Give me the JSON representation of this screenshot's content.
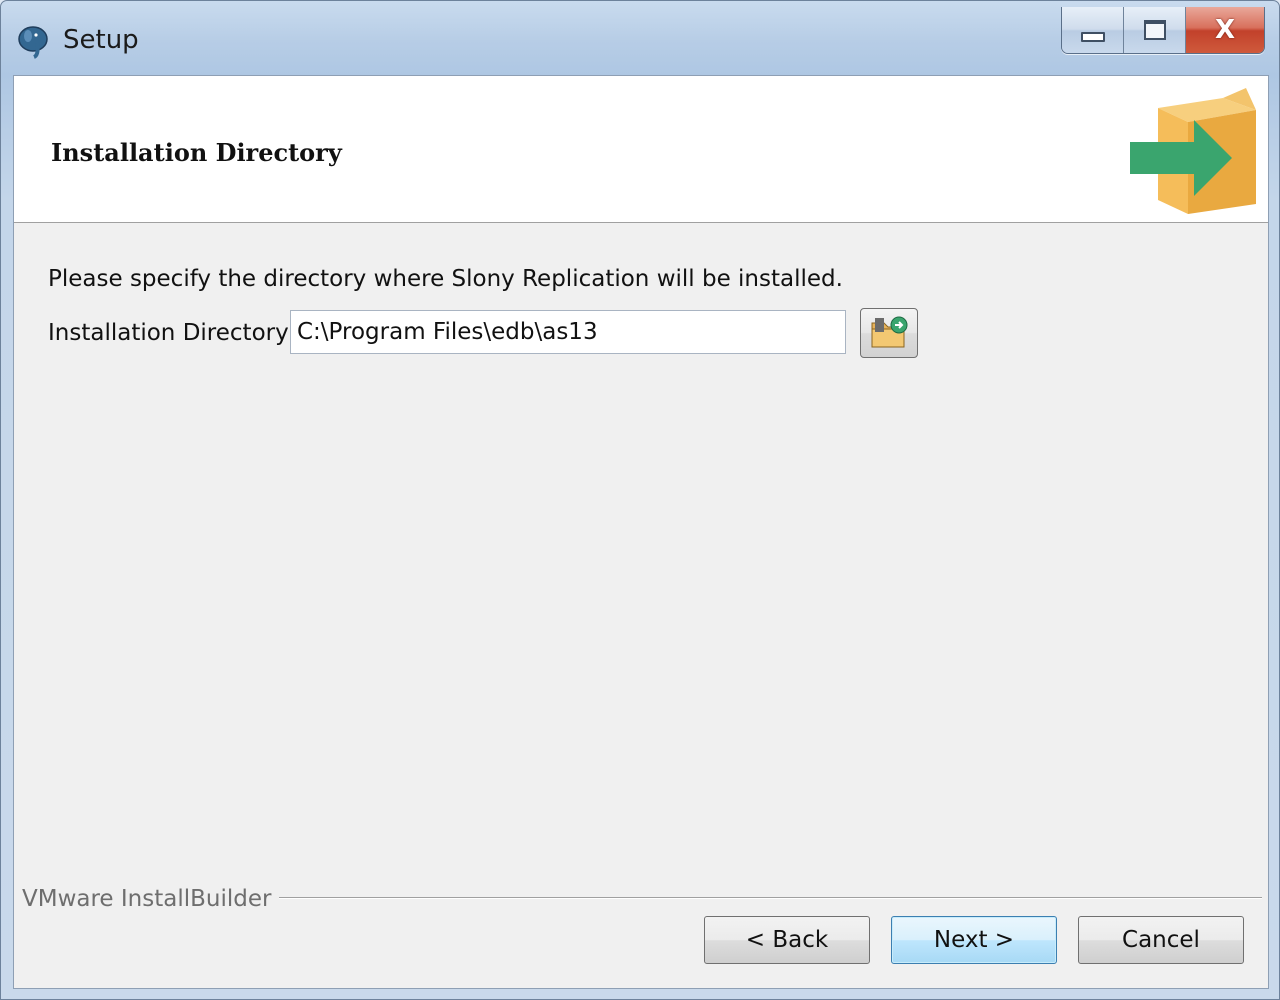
{
  "window": {
    "title": "Setup",
    "app_icon": "postgres-elephant-icon",
    "controls": {
      "minimize_icon": "minimize-icon",
      "maximize_icon": "maximize-icon",
      "close_glyph": "X"
    }
  },
  "header": {
    "title": "Installation Directory",
    "icon": "package-box-arrow-icon"
  },
  "body": {
    "description": "Please specify the directory where Slony Replication will be installed.",
    "directory_label": "Installation Directory",
    "directory_value": "C:\\Program Files\\edb\\as13",
    "browse_icon": "folder-browse-icon"
  },
  "footer": {
    "brand": "VMware InstallBuilder",
    "back_label": "< Back",
    "next_label": "Next >",
    "cancel_label": "Cancel"
  },
  "colors": {
    "accent_green": "#3aa56e",
    "box_orange": "#f0b552",
    "default_button_border": "#3c7fb1"
  }
}
